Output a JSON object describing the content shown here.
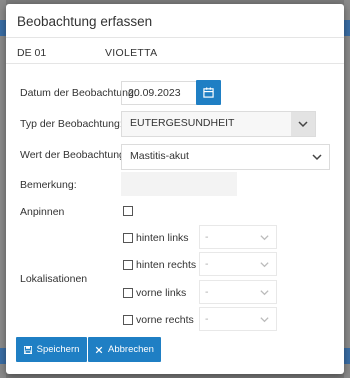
{
  "dialog": {
    "title": "Beobachtung erfassen"
  },
  "animal": {
    "id": "DE 01",
    "name": "VIOLETTA"
  },
  "form": {
    "date_label": "Datum der Beobachtung:",
    "date_value": "20.09.2023",
    "type_label": "Typ der Beobachtung:",
    "type_value": "EUTERGESUNDHEIT",
    "value_label": "Wert der Beobachtung:",
    "value_value": "Mastitis-akut",
    "remark_label": "Bemerkung:",
    "remark_value": "",
    "pin_label": "Anpinnen",
    "pin_checked": false,
    "localization_label": "Lokalisationen",
    "localizations": [
      {
        "label": "hinten links",
        "checked": false,
        "select_value": "-"
      },
      {
        "label": "hinten rechts",
        "checked": false,
        "select_value": "-"
      },
      {
        "label": "vorne links",
        "checked": false,
        "select_value": "-"
      },
      {
        "label": "vorne rechts",
        "checked": false,
        "select_value": "-"
      }
    ]
  },
  "footer": {
    "save_label": "Speichern",
    "cancel_label": "Abbrechen"
  },
  "colors": {
    "primary": "#1f7fc4",
    "overlay": "#7a7a7a"
  },
  "icons": {
    "calendar": "calendar-icon",
    "save": "floppy-disk-icon",
    "cancel": "close-icon",
    "dropdown": "chevron-down-icon"
  }
}
